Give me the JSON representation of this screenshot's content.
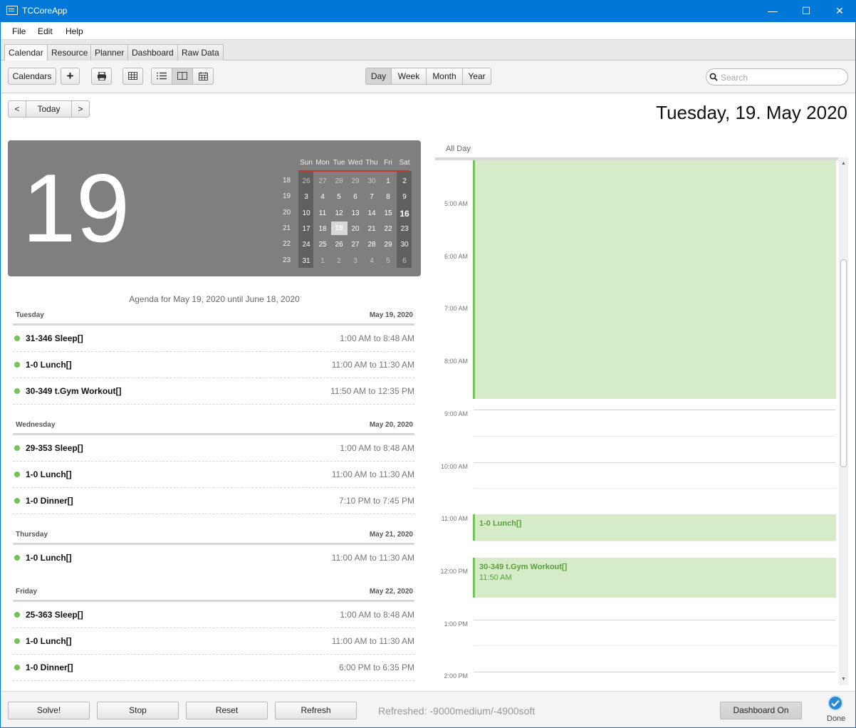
{
  "window": {
    "title": "TCCoreApp",
    "min": "—",
    "max": "☐",
    "close": "✕"
  },
  "menu": [
    "File",
    "Edit",
    "Help"
  ],
  "tabs": [
    "Calendar",
    "Resource",
    "Planner",
    "Dashboard",
    "Raw Data"
  ],
  "toolbar": {
    "calendars": "Calendars",
    "add": "+",
    "views": [
      "Day",
      "Week",
      "Month",
      "Year"
    ],
    "active_view": "Day",
    "search_placeholder": "Search"
  },
  "nav": {
    "prev": "<",
    "today": "Today",
    "next": ">"
  },
  "date_header": "Tuesday, 19. May 2020",
  "big_day": "19",
  "mini_calendar": {
    "weekdays": [
      "Sun",
      "Mon",
      "Tue",
      "Wed",
      "Thu",
      "Fri",
      "Sat"
    ],
    "weeks": [
      {
        "no": "18",
        "days": [
          "26",
          "27",
          "28",
          "29",
          "30",
          "1",
          "2"
        ]
      },
      {
        "no": "19",
        "days": [
          "3",
          "4",
          "5",
          "6",
          "7",
          "8",
          "9"
        ]
      },
      {
        "no": "20",
        "days": [
          "10",
          "11",
          "12",
          "13",
          "14",
          "15",
          "16"
        ]
      },
      {
        "no": "21",
        "days": [
          "17",
          "18",
          "19",
          "20",
          "21",
          "22",
          "23"
        ]
      },
      {
        "no": "22",
        "days": [
          "24",
          "25",
          "26",
          "27",
          "28",
          "29",
          "30"
        ]
      },
      {
        "no": "23",
        "days": [
          "31",
          "1",
          "2",
          "3",
          "4",
          "5",
          "6"
        ]
      }
    ],
    "selected": "19",
    "today": "16"
  },
  "agenda": {
    "title": "Agenda for May 19, 2020 until June 18, 2020",
    "days": [
      {
        "weekday": "Tuesday",
        "date": "May 19, 2020",
        "events": [
          {
            "name": "31-346 Sleep[]",
            "time": "1:00 AM to 8:48 AM"
          },
          {
            "name": "1-0 Lunch[]",
            "time": "11:00 AM to 11:30 AM"
          },
          {
            "name": "30-349 t.Gym Workout[]",
            "time": "11:50 AM to 12:35 PM"
          }
        ]
      },
      {
        "weekday": "Wednesday",
        "date": "May 20, 2020",
        "events": [
          {
            "name": "29-353 Sleep[]",
            "time": "1:00 AM to 8:48 AM"
          },
          {
            "name": "1-0 Lunch[]",
            "time": "11:00 AM to 11:30 AM"
          },
          {
            "name": "1-0 Dinner[]",
            "time": "7:10 PM to 7:45 PM"
          }
        ]
      },
      {
        "weekday": "Thursday",
        "date": "May 21, 2020",
        "events": [
          {
            "name": "1-0 Lunch[]",
            "time": "11:00 AM to 11:30 AM"
          }
        ]
      },
      {
        "weekday": "Friday",
        "date": "May 22, 2020",
        "events": [
          {
            "name": "25-363 Sleep[]",
            "time": "1:00 AM to 8:48 AM"
          },
          {
            "name": "1-0 Lunch[]",
            "time": "11:00 AM to 11:30 AM"
          },
          {
            "name": "1-0 Dinner[]",
            "time": "6:00 PM to 6:35 PM"
          }
        ]
      }
    ]
  },
  "day_view": {
    "all_day": "All Day",
    "hours": [
      "5:00 AM",
      "6:00 AM",
      "7:00 AM",
      "8:00 AM",
      "9:00 AM",
      "10:00 AM",
      "11:00 AM",
      "12:00 PM",
      "1:00 PM",
      "2:00 PM"
    ],
    "events": [
      {
        "title": "",
        "time": ""
      },
      {
        "title": "1-0 Lunch[]",
        "time": ""
      },
      {
        "title": "30-349 t.Gym Workout[]",
        "time": "11:50 AM"
      }
    ]
  },
  "bottom": {
    "solve": "Solve!",
    "stop": "Stop",
    "reset": "Reset",
    "refresh": "Refresh",
    "status": "Refreshed: -9000medium/-4900soft",
    "dashboard": "Dashboard On",
    "done": "Done"
  },
  "colors": {
    "titlebar": "#0078d7",
    "event_green": "#77c05a",
    "event_fill": "#d6ecc9",
    "card_gray": "#7f7f7f"
  }
}
